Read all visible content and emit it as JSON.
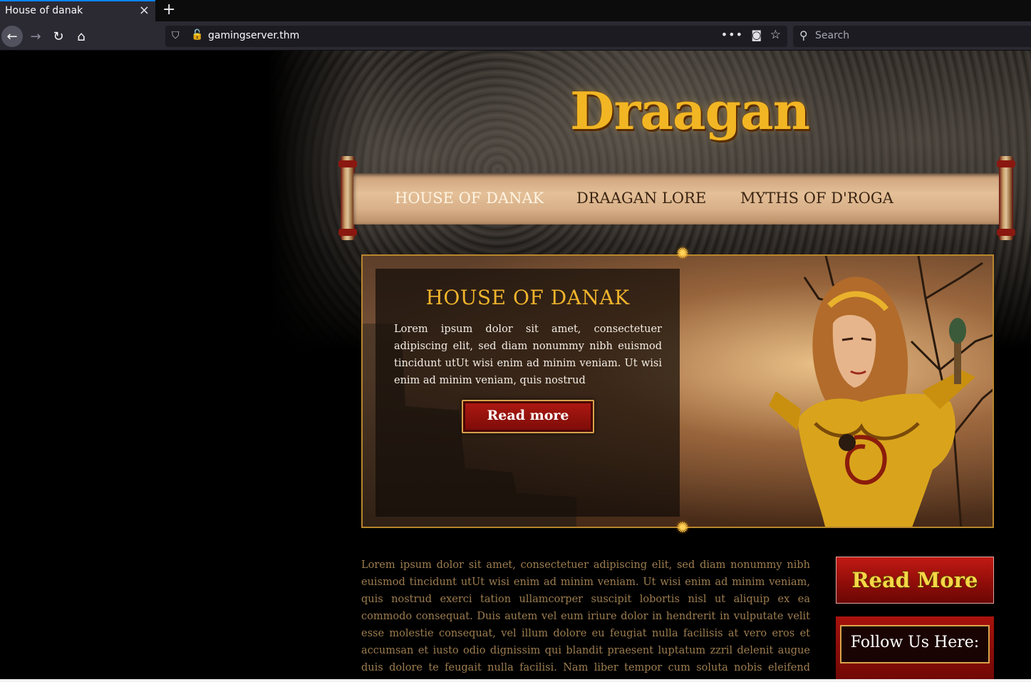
{
  "browser": {
    "tab_title": "House of danak",
    "tab_close": "×",
    "new_tab": "+",
    "url": "gamingserver.thm",
    "search_placeholder": "Search",
    "icons": {
      "back": "←",
      "forward": "→",
      "reload": "↻",
      "home": "⌂",
      "shield": "⛉",
      "insecure": "🔓",
      "more": "•••",
      "pocket": "◙",
      "star": "☆",
      "search": "⚲"
    }
  },
  "site": {
    "logo": "Draagan",
    "nav": [
      {
        "label": "HOUSE OF DANAK",
        "active": true
      },
      {
        "label": "DRAAGAN LORE",
        "active": false
      },
      {
        "label": "MYTHS OF D'ROGA",
        "active": false
      }
    ],
    "hero": {
      "title": "HOUSE OF DANAK",
      "text": "Lorem ipsum dolor sit amet, consectetuer adipiscing elit, sed diam nonummy nibh euismod tincidunt utUt wisi enim ad minim veniam. Ut wisi enim ad minim veniam, quis nostrud",
      "button": "Read more"
    },
    "body_text": "Lorem ipsum dolor sit amet, consectetuer adipiscing elit, sed diam nonummy nibh euismod tincidunt utUt wisi enim ad minim veniam. Ut wisi enim ad minim veniam, quis nostrud exerci tation ullamcorper suscipit lobortis nisl ut aliquip ex ea commodo consequat. Duis autem vel eum iriure dolor in hendrerit in vulputate velit esse molestie consequat, vel illum dolore eu feugiat nulla facilisis at vero eros et accumsan et iusto odio dignissim qui blandit praesent luptatum zzril delenit augue duis dolore te feugait nulla facilisi. Nam liber tempor cum soluta nobis eleifend option congue nihil imperdiet",
    "sidebar": {
      "read_more": "Read More",
      "follow": "Follow Us Here:"
    },
    "ornament": "✺"
  }
}
